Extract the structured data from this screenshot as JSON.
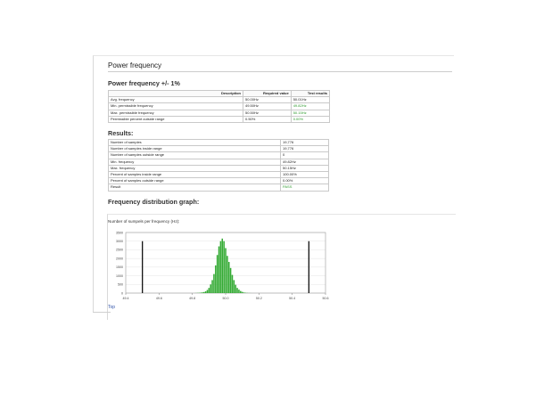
{
  "page_title": "Power frequency",
  "section_title": "Power frequency +/- 1%",
  "requirements_table": {
    "headers": [
      "Description",
      "Required value",
      "Test results"
    ],
    "rows": [
      {
        "description": "Avg. frequency",
        "required": "50.00Hz",
        "result": "50.01Hz",
        "result_color": "#222222"
      },
      {
        "description": "Min. permissible frequency",
        "required": "49.50Hz",
        "result": "49.82Hz",
        "result_color": "#2e9a2e"
      },
      {
        "description": "Max. permissible frequency",
        "required": "50.50Hz",
        "result": "50.15Hz",
        "result_color": "#2e9a2e"
      },
      {
        "description": "Permissible percent outside range",
        "required": "0.50%",
        "result": "0.00%",
        "result_color": "#2e9a2e"
      }
    ]
  },
  "results_title": "Results:",
  "results_table": {
    "rows": [
      {
        "label": "Number of samples",
        "value": "19,776"
      },
      {
        "label": "Number of samples inside range",
        "value": "19,776"
      },
      {
        "label": "Number of samples outside range",
        "value": "0"
      },
      {
        "label": "Min. frequency",
        "value": "49.82Hz"
      },
      {
        "label": "Max. frequency",
        "value": "50.15Hz"
      },
      {
        "label": "Percent of samples inside range",
        "value": "100.00%"
      },
      {
        "label": "Percent of samples outside range",
        "value": "0.00%"
      },
      {
        "label": "Result",
        "value": "PASS",
        "value_color": "#2e9a2e"
      }
    ]
  },
  "graph_title": "Frequency distribution graph:",
  "graph_caption": "Number of sumpels per frequency (Hz):",
  "top_link": "Top",
  "chart_data": {
    "type": "bar",
    "x": [
      49.8,
      49.81,
      49.82,
      49.83,
      49.84,
      49.85,
      49.86,
      49.87,
      49.88,
      49.89,
      49.9,
      49.91,
      49.92,
      49.93,
      49.94,
      49.95,
      49.96,
      49.97,
      49.98,
      49.99,
      50.0,
      50.01,
      50.02,
      50.03,
      50.04,
      50.05,
      50.06,
      50.07,
      50.08,
      50.09,
      50.1,
      50.11,
      50.12,
      50.13,
      50.14,
      50.15,
      50.16,
      50.17,
      50.18,
      50.19,
      50.2
    ],
    "values": [
      0,
      0,
      5,
      10,
      15,
      25,
      40,
      60,
      100,
      180,
      300,
      500,
      750,
      1100,
      1600,
      2200,
      2700,
      3000,
      3150,
      3000,
      2600,
      2150,
      1800,
      1450,
      1050,
      750,
      480,
      300,
      200,
      120,
      70,
      35,
      20,
      10,
      5,
      3,
      0,
      0,
      0,
      0,
      0
    ],
    "ylim": [
      0,
      3500
    ],
    "y_ticks": [
      0,
      500,
      1000,
      1500,
      2000,
      2500,
      3000,
      3500
    ],
    "xlim": [
      49.4,
      50.6
    ],
    "x_tick_values": [
      49.4,
      49.6,
      49.8,
      50.0,
      50.2,
      50.4,
      50.6
    ],
    "x_tick_labels": [
      "49.4",
      "49.6",
      "49.8",
      "50.0",
      "50.2",
      "50.4",
      "50.6"
    ],
    "limit_lines": [
      49.5,
      50.5
    ],
    "bar_color": "#33aa33",
    "limit_color": "#111111",
    "grid": true
  }
}
